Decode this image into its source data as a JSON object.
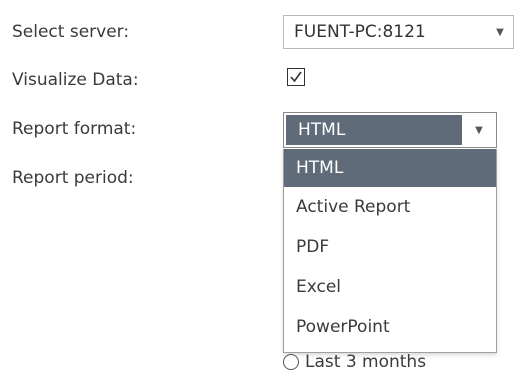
{
  "labels": {
    "server": "Select server:",
    "visualize": "Visualize Data:",
    "format": "Report format:",
    "period": "Report period:"
  },
  "server_select": {
    "value": "FUENT-PC:8121",
    "icon": "chevron-down-icon"
  },
  "visualize_checkbox": {
    "checked": true
  },
  "format_select": {
    "value": "HTML",
    "icon": "chevron-down-icon",
    "options": [
      "HTML",
      "Active Report",
      "PDF",
      "Excel",
      "PowerPoint"
    ],
    "selected_index": 0
  },
  "period_radio": {
    "label": "Last 3 months",
    "checked": false
  },
  "colors": {
    "selection": "#5f6b78",
    "border": "#b9b9b9"
  }
}
